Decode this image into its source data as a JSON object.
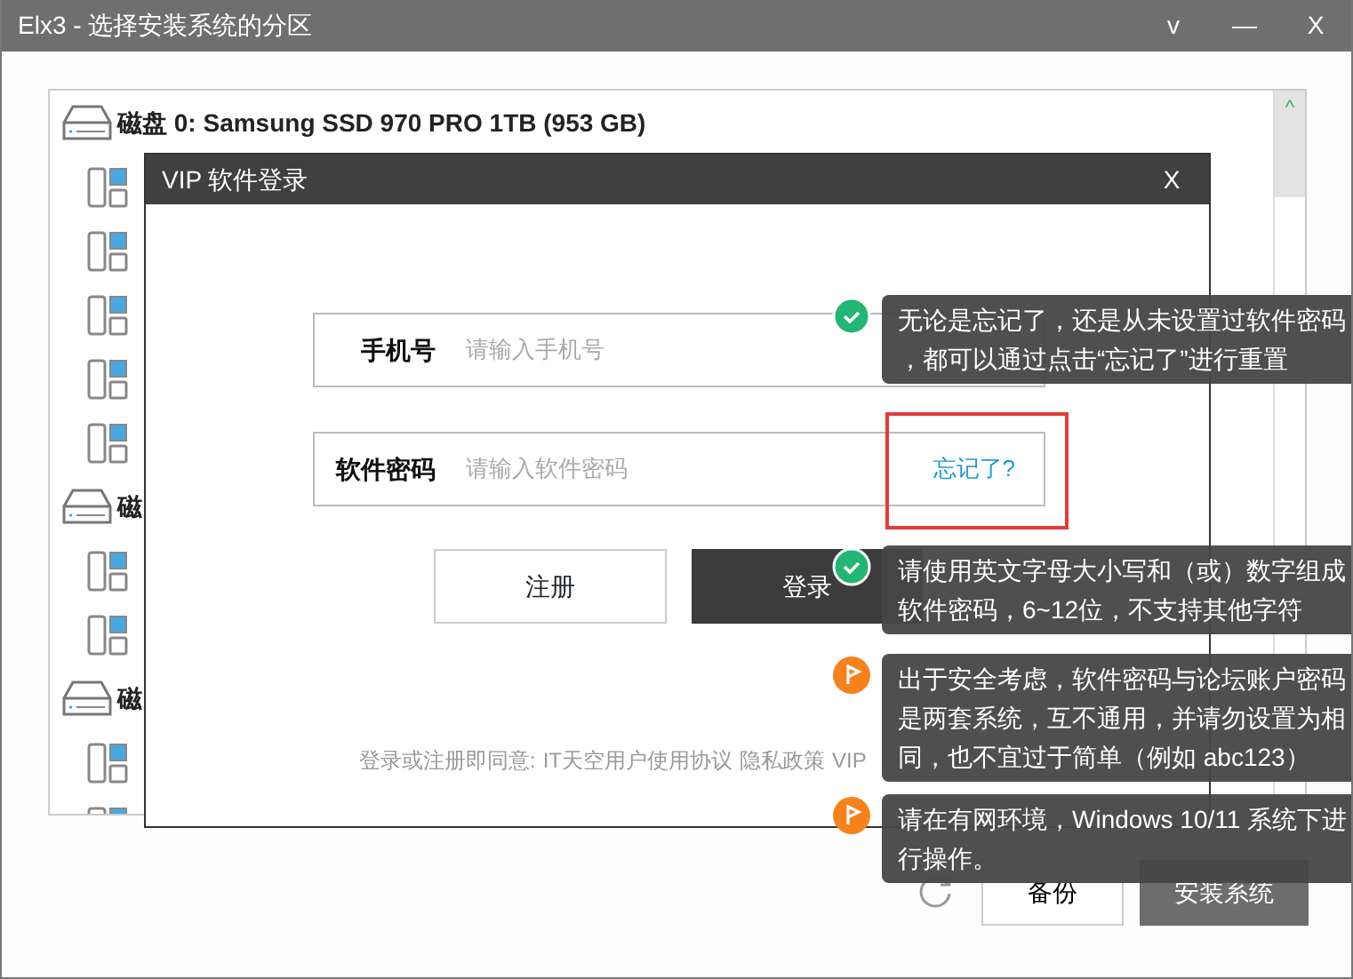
{
  "window": {
    "title": "Elx3 - 选择安装系统的分区",
    "controls": [
      "v",
      "—",
      "X"
    ]
  },
  "disk_list": {
    "scroll_up": "^",
    "items": [
      {
        "kind": "disk",
        "label": "磁盘 0: Samsung SSD 970 PRO 1TB (953 GB)"
      },
      {
        "kind": "partition"
      },
      {
        "kind": "partition"
      },
      {
        "kind": "partition"
      },
      {
        "kind": "partition"
      },
      {
        "kind": "partition"
      },
      {
        "kind": "disk",
        "label": "磁"
      },
      {
        "kind": "partition"
      },
      {
        "kind": "partition"
      },
      {
        "kind": "disk",
        "label": "磁"
      },
      {
        "kind": "partition"
      },
      {
        "kind": "partition"
      }
    ]
  },
  "actions": {
    "backup": "备份",
    "install": "安装系统"
  },
  "dialog": {
    "title": "VIP 软件登录",
    "close": "X",
    "fields": [
      {
        "label": "手机号",
        "placeholder": "请输入手机号"
      },
      {
        "label": "软件密码",
        "placeholder": "请输入软件密码"
      }
    ],
    "forgot_link": "忘记了?",
    "buttons": [
      {
        "label": "注册",
        "kind": "secondary"
      },
      {
        "label": "登录",
        "kind": "primary"
      }
    ],
    "agreement": {
      "text": "登录或注册即同意:",
      "links": [
        "IT天空用户使用协议",
        "隐私政策",
        "VIP"
      ]
    }
  },
  "annotations": [
    {
      "kind": "check",
      "text": "无论是忘记了，还是从未设置过软件密码，都可以通过点击“忘记了”进行重置"
    },
    {
      "kind": "check",
      "text": "请使用英文字母大小写和（或）数字组成软件密码，6~12位，不支持其他字符"
    },
    {
      "kind": "flag",
      "text": "出于安全考虑，软件密码与论坛账户密码是两套系统，互不通用，并请勿设置为相同，也不宜过于简单（例如 abc123）"
    },
    {
      "kind": "flag",
      "text": "请在有网环境，Windows 10/11 系统下进行操作。"
    }
  ]
}
